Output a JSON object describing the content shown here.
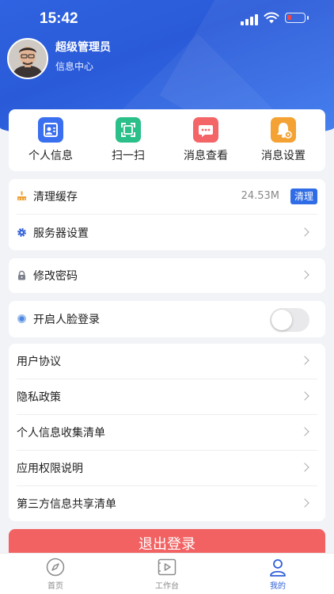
{
  "status_bar": {
    "time": "15:42"
  },
  "profile": {
    "name": "超级管理员",
    "department": "信息中心"
  },
  "quick_actions": [
    {
      "label": "个人信息",
      "icon": "person-card-icon",
      "color": "#3a6ff0"
    },
    {
      "label": "扫一扫",
      "icon": "scan-icon",
      "color": "#2bbf8a"
    },
    {
      "label": "消息查看",
      "icon": "message-icon",
      "color": "#f46567"
    },
    {
      "label": "消息设置",
      "icon": "bell-settings-icon",
      "color": "#f4a233"
    }
  ],
  "settings": {
    "clear_cache": {
      "label": "清理缓存",
      "size": "24.53M",
      "button": "清理"
    },
    "server_settings": {
      "label": "服务器设置"
    },
    "change_password": {
      "label": "修改密码"
    },
    "face_login": {
      "label": "开启人脸登录",
      "enabled": false
    }
  },
  "legal_list": [
    {
      "label": "用户协议"
    },
    {
      "label": "隐私政策"
    },
    {
      "label": "个人信息收集清单"
    },
    {
      "label": "应用权限说明"
    },
    {
      "label": "第三方信息共享清单"
    }
  ],
  "logout_label": "退出登录",
  "tabbar": {
    "tabs": [
      {
        "label": "首页",
        "icon": "compass-icon"
      },
      {
        "label": "工作台",
        "icon": "play-box-icon"
      },
      {
        "label": "我的",
        "icon": "user-icon",
        "active": true
      }
    ]
  },
  "colors": {
    "primary": "#2f6ce5",
    "header": "#2f63e0",
    "danger": "#f26262"
  }
}
